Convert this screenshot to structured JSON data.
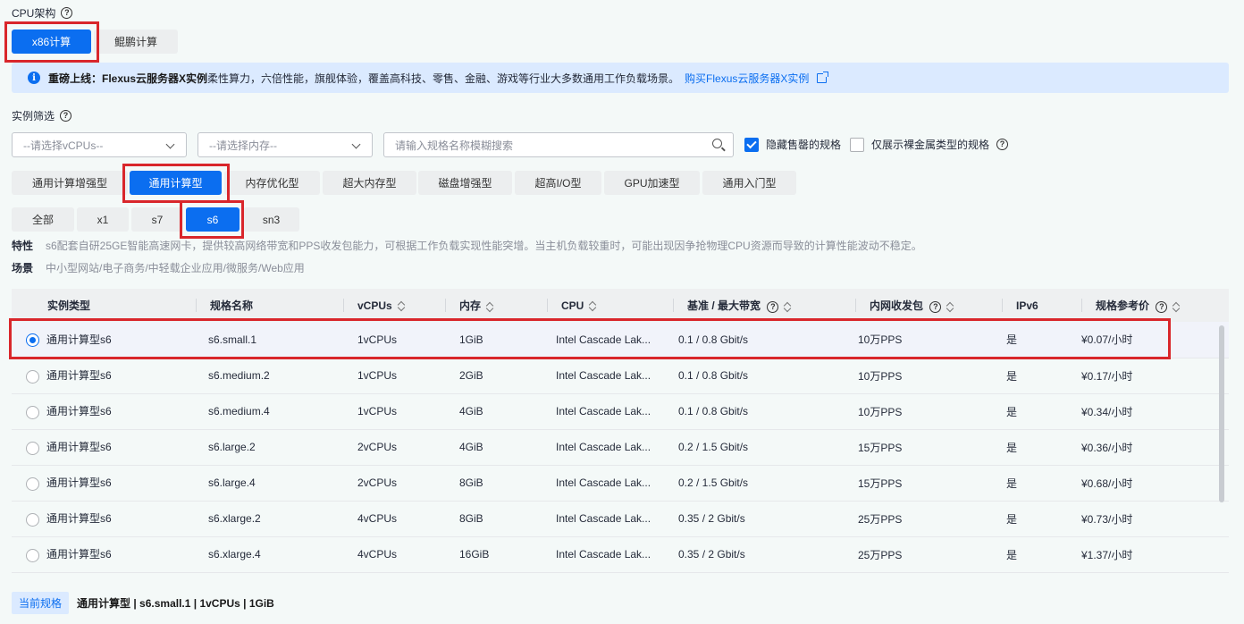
{
  "arch": {
    "label": "CPU架构",
    "options": [
      "x86计算",
      "鲲鹏计算"
    ],
    "selected": "x86计算"
  },
  "banner": {
    "icon": "info-icon",
    "strong": "重磅上线：Flexus云服务器X实例",
    "text": " 柔性算力，六倍性能，旗舰体验，覆盖高科技、零售、金融、游戏等行业大多数通用工作负载场景。",
    "link": "购买Flexus云服务器X实例"
  },
  "filter": {
    "label": "实例筛选",
    "vcpu_placeholder": "--请选择vCPUs--",
    "mem_placeholder": "--请选择内存--",
    "search_placeholder": "请输入规格名称模糊搜索",
    "hide_soldout": "隐藏售罄的规格",
    "hide_soldout_checked": true,
    "baremetal_only": "仅展示裸金属类型的规格",
    "baremetal_only_checked": false
  },
  "types": {
    "items": [
      "通用计算增强型",
      "通用计算型",
      "内存优化型",
      "超大内存型",
      "磁盘增强型",
      "超高I/O型",
      "GPU加速型",
      "通用入门型"
    ],
    "selected": "通用计算型"
  },
  "series": {
    "items": [
      "全部",
      "x1",
      "s7",
      "s6",
      "sn3"
    ],
    "selected": "s6"
  },
  "desc": {
    "feature_label": "特性",
    "feature": "s6配套自研25GE智能高速网卡，提供较高网络带宽和PPS收发包能力，可根据工作负载实现性能突增。当主机负载较重时，可能出现因争抢物理CPU资源而导致的计算性能波动不稳定。",
    "scene_label": "场景",
    "scene": "中小型网站/电子商务/中轻载企业应用/微服务/Web应用"
  },
  "table": {
    "headers": [
      "实例类型",
      "规格名称",
      "vCPUs",
      "内存",
      "CPU",
      "基准 / 最大带宽",
      "内网收发包",
      "IPv6",
      "规格参考价"
    ],
    "rows": [
      [
        "通用计算型s6",
        "s6.small.1",
        "1vCPUs",
        "1GiB",
        "Intel Cascade Lak...",
        "0.1 / 0.8 Gbit/s",
        "10万PPS",
        "是",
        "¥0.07/小时"
      ],
      [
        "通用计算型s6",
        "s6.medium.2",
        "1vCPUs",
        "2GiB",
        "Intel Cascade Lak...",
        "0.1 / 0.8 Gbit/s",
        "10万PPS",
        "是",
        "¥0.17/小时"
      ],
      [
        "通用计算型s6",
        "s6.medium.4",
        "1vCPUs",
        "4GiB",
        "Intel Cascade Lak...",
        "0.1 / 0.8 Gbit/s",
        "10万PPS",
        "是",
        "¥0.34/小时"
      ],
      [
        "通用计算型s6",
        "s6.large.2",
        "2vCPUs",
        "4GiB",
        "Intel Cascade Lak...",
        "0.2 / 1.5 Gbit/s",
        "15万PPS",
        "是",
        "¥0.36/小时"
      ],
      [
        "通用计算型s6",
        "s6.large.4",
        "2vCPUs",
        "8GiB",
        "Intel Cascade Lak...",
        "0.2 / 1.5 Gbit/s",
        "15万PPS",
        "是",
        "¥0.68/小时"
      ],
      [
        "通用计算型s6",
        "s6.xlarge.2",
        "4vCPUs",
        "8GiB",
        "Intel Cascade Lak...",
        "0.35 / 2 Gbit/s",
        "25万PPS",
        "是",
        "¥0.73/小时"
      ],
      [
        "通用计算型s6",
        "s6.xlarge.4",
        "4vCPUs",
        "16GiB",
        "Intel Cascade Lak...",
        "0.35 / 2 Gbit/s",
        "25万PPS",
        "是",
        "¥1.37/小时"
      ]
    ],
    "selected_row": 0
  },
  "footer": {
    "tag": "当前规格",
    "value": "通用计算型 |  s6.small.1 | 1vCPUs | 1GiB"
  },
  "colors": {
    "accent": "#0b6ef0",
    "highlight": "#d9262b",
    "background": "#f4f9f8"
  }
}
